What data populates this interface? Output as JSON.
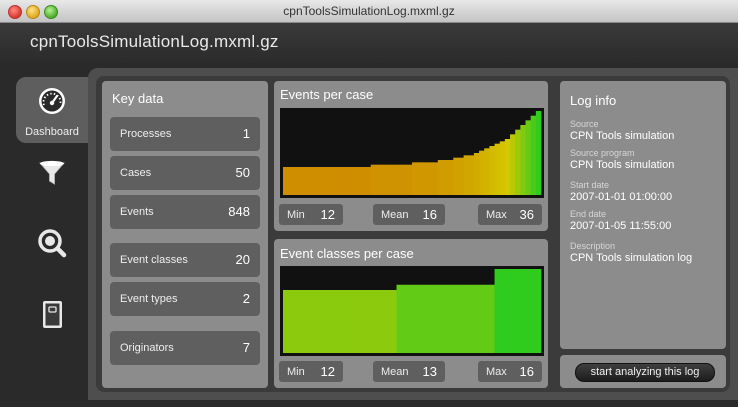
{
  "window": {
    "title": "cpnToolsSimulationLog.mxml.gz"
  },
  "header": {
    "title": "cpnToolsSimulationLog.mxml.gz"
  },
  "sidebar": {
    "items": [
      {
        "label": "Dashboard",
        "icon": "dashboard-gauge-icon",
        "active": true
      },
      {
        "label": "",
        "icon": "filter-funnel-icon",
        "active": false
      },
      {
        "label": "",
        "icon": "magnifier-icon",
        "active": false
      },
      {
        "label": "",
        "icon": "notebook-icon",
        "active": false
      }
    ]
  },
  "key_data": {
    "title": "Key data",
    "rows": [
      {
        "label": "Processes",
        "value": "1"
      },
      {
        "label": "Cases",
        "value": "50"
      },
      {
        "label": "Events",
        "value": "848"
      },
      {
        "label": "Event classes",
        "value": "20"
      },
      {
        "label": "Event types",
        "value": "2"
      },
      {
        "label": "Originators",
        "value": "7"
      }
    ]
  },
  "events_per_case": {
    "title": "Events per case",
    "min_label": "Min",
    "min": "12",
    "mean_label": "Mean",
    "mean": "16",
    "max_label": "Max",
    "max": "36",
    "chart_data": {
      "type": "bar",
      "values": [
        12,
        12,
        12,
        12,
        12,
        12,
        12,
        12,
        12,
        12,
        12,
        12,
        12,
        12,
        12,
        12,
        12,
        13,
        13,
        13,
        13,
        13,
        13,
        13,
        13,
        14,
        14,
        14,
        14,
        14,
        15,
        15,
        15,
        16,
        16,
        17,
        17,
        18,
        19,
        20,
        21,
        22,
        23,
        24,
        26,
        28,
        30,
        32,
        34,
        36
      ],
      "ylim": [
        0,
        36
      ]
    }
  },
  "event_classes_per_case": {
    "title": "Event classes per case",
    "min_label": "Min",
    "min": "12",
    "mean_label": "Mean",
    "mean": "13",
    "max_label": "Max",
    "max": "16",
    "chart_data": {
      "type": "bar",
      "values": [
        12,
        12,
        12,
        12,
        12,
        12,
        12,
        12,
        12,
        12,
        12,
        12,
        12,
        12,
        12,
        12,
        12,
        12,
        12,
        12,
        12,
        12,
        13,
        13,
        13,
        13,
        13,
        13,
        13,
        13,
        13,
        13,
        13,
        13,
        13,
        13,
        13,
        13,
        13,
        13,
        13,
        16,
        16,
        16,
        16,
        16,
        16,
        16,
        16,
        16
      ],
      "ylim": [
        0,
        16
      ]
    }
  },
  "log_info": {
    "title": "Log info",
    "fields": [
      {
        "label": "Source",
        "value": "CPN Tools simulation"
      },
      {
        "label": "Source program",
        "value": "CPN Tools simulation"
      },
      {
        "label": "Start date",
        "value": "2007-01-01 01:00:00"
      },
      {
        "label": "End date",
        "value": "2007-01-05 11:55:00"
      },
      {
        "label": "Description",
        "value": "CPN Tools simulation log"
      }
    ]
  },
  "actions": {
    "start_label": "start analyzing this log"
  },
  "colors": {
    "bar_low": "#cf8d00",
    "bar_high": "#2fcc1e",
    "chart_bg": "#111111",
    "panel_bg": "#8c8c8c"
  }
}
